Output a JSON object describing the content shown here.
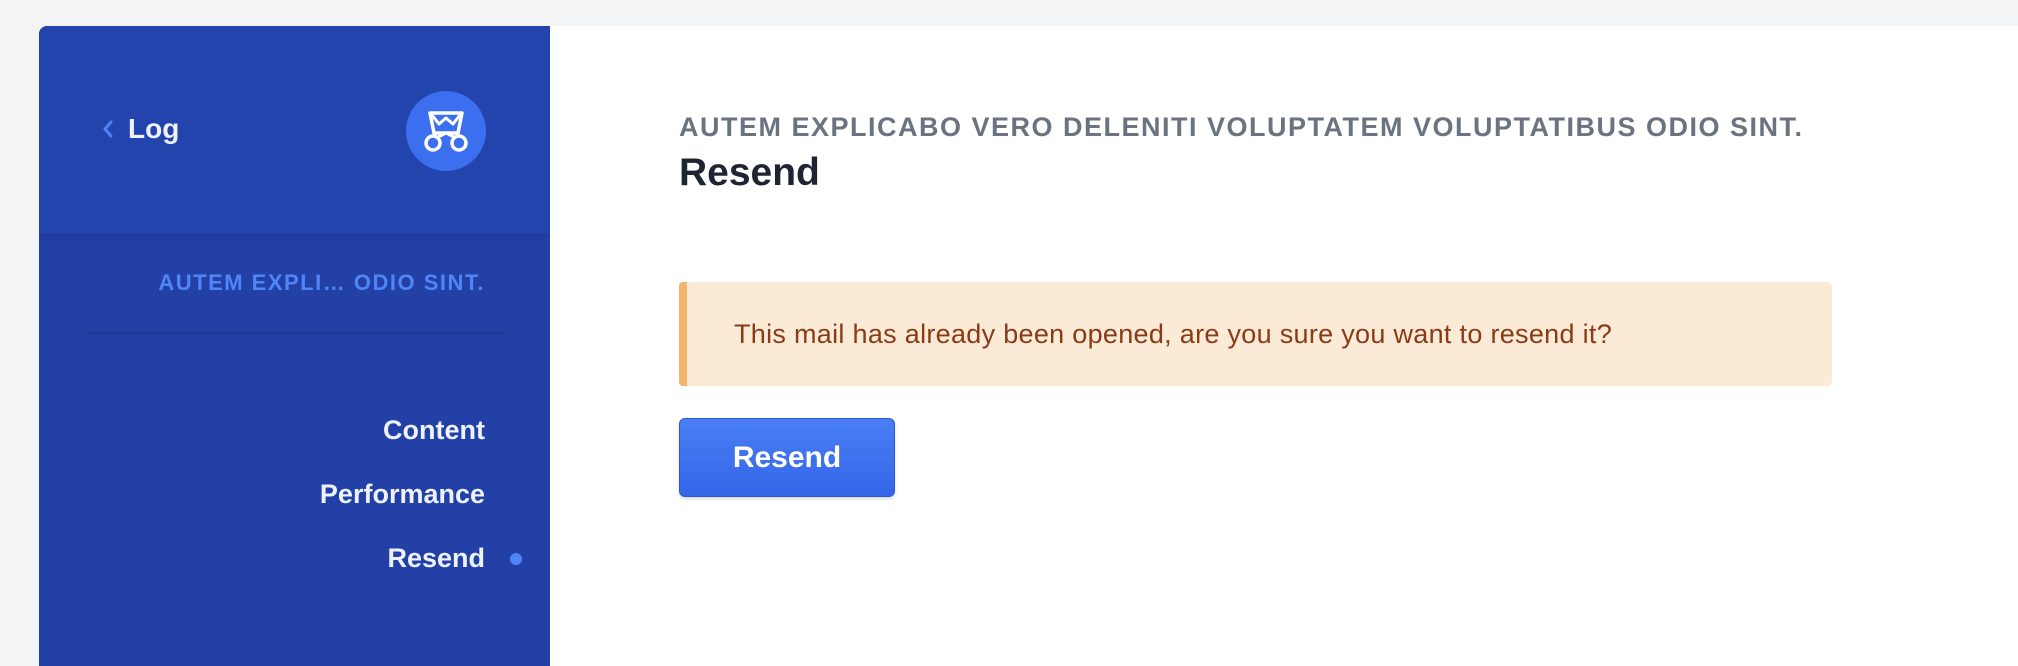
{
  "sidebar": {
    "back_label": "Log",
    "logo_icon": "mail-courier-logo-icon",
    "section_label": "AUTEM EXPLI… ODIO SINT.",
    "nav_items": [
      {
        "label": "Content",
        "active": false
      },
      {
        "label": "Performance",
        "active": false
      },
      {
        "label": "Resend",
        "active": true
      }
    ]
  },
  "main": {
    "kicker": "AUTEM EXPLICABO VERO DELENITI VOLUPTATEM VOLUPTATIBUS ODIO SINT.",
    "title": "Resend",
    "alert_text": "This mail has already been opened, are you sure you want to resend it?",
    "resend_button_label": "Resend"
  },
  "colors": {
    "sidebar_bg": "#2340a6",
    "accent": "#4f86f7",
    "button": "#3b6ff0",
    "alert_bg": "#fbebd6",
    "alert_border": "#f0b46c",
    "alert_text": "#8a3a16"
  }
}
